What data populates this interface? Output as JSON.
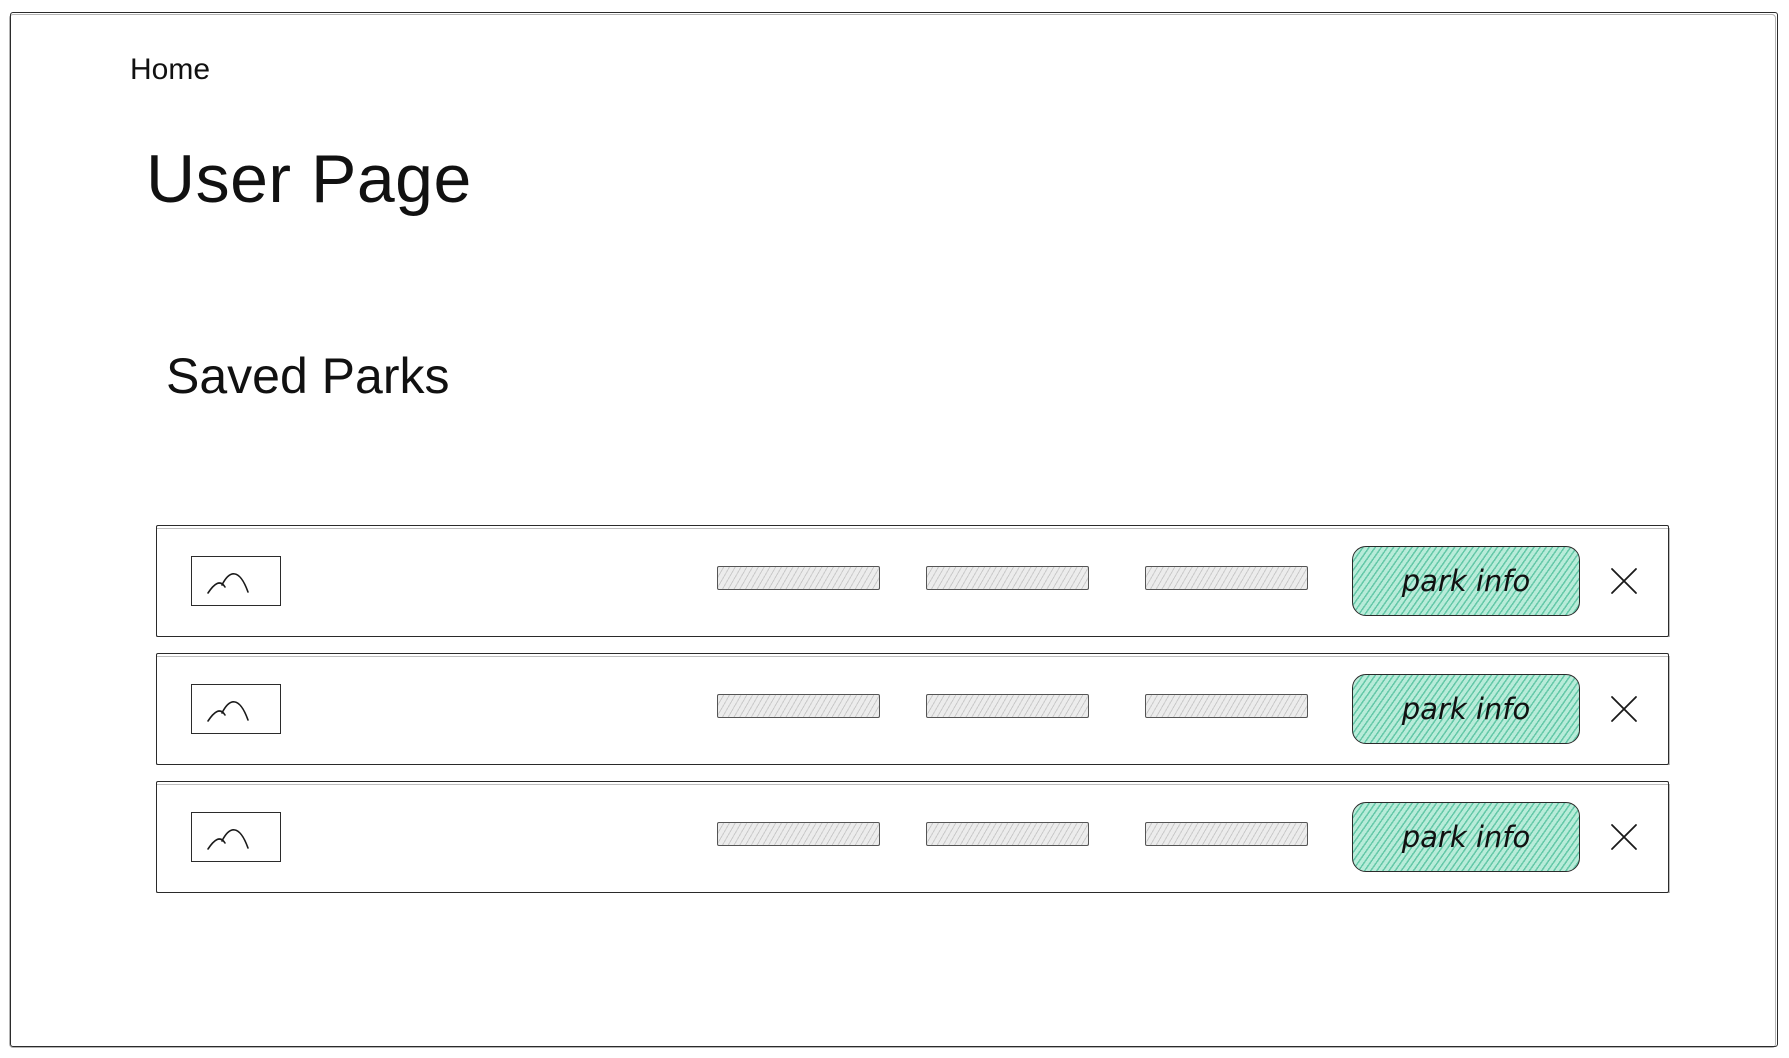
{
  "nav": {
    "home_label": "Home"
  },
  "page": {
    "title": "User Page"
  },
  "saved_parks": {
    "title": "Saved Parks",
    "items": [
      {
        "image_icon": "image-placeholder-icon",
        "info_label": "park info",
        "remove_icon": "close-icon"
      },
      {
        "image_icon": "image-placeholder-icon",
        "info_label": "park info",
        "remove_icon": "close-icon"
      },
      {
        "image_icon": "image-placeholder-icon",
        "info_label": "park info",
        "remove_icon": "close-icon"
      }
    ]
  },
  "colors": {
    "button_fill": "#b8ecd9",
    "button_hatch": "#20aa80",
    "placeholder_fill": "#ececec",
    "stroke": "#2b2b2b"
  }
}
